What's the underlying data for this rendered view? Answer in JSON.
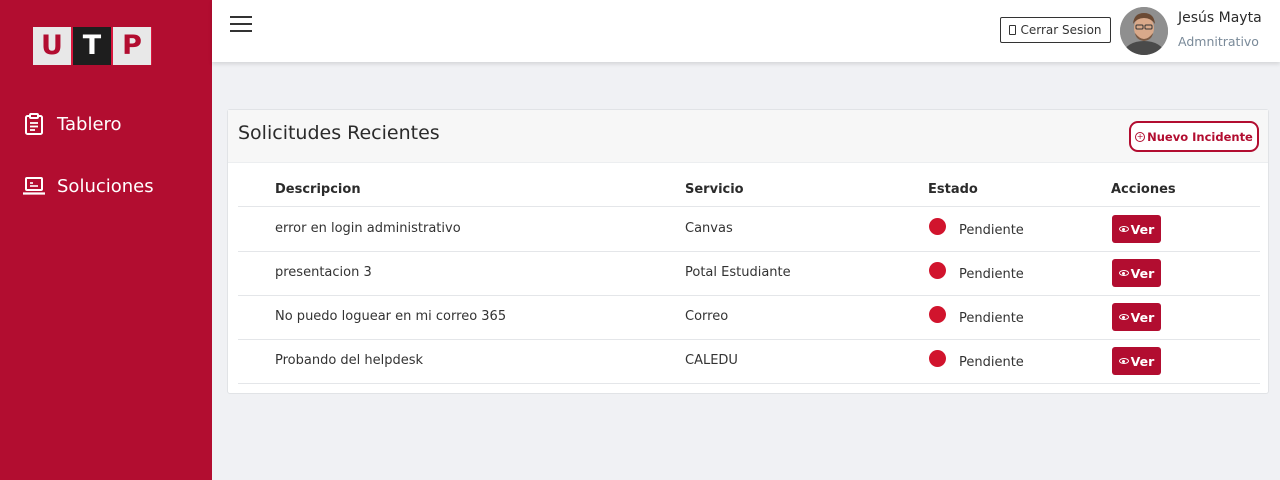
{
  "brand": {
    "letters": [
      "U",
      "T",
      "P"
    ]
  },
  "sidebar": {
    "items": [
      {
        "label": "Tablero",
        "icon": "clipboard-icon"
      },
      {
        "label": "Soluciones",
        "icon": "laptop-icon"
      }
    ]
  },
  "header": {
    "logout_label": "Cerrar Sesion",
    "user_name": "Jesús Mayta",
    "user_role": "Admnitrativo"
  },
  "card": {
    "title": "Solicitudes Recientes",
    "new_button_label": "Nuevo Incidente",
    "columns": [
      "Descripcion",
      "Servicio",
      "Estado",
      "Acciones"
    ],
    "rows": [
      {
        "descripcion": "error en login administrativo",
        "servicio": "Canvas",
        "estado": "Pendiente",
        "accion": "Ver"
      },
      {
        "descripcion": "presentacion 3",
        "servicio": "Potal Estudiante",
        "estado": "Pendiente",
        "accion": "Ver"
      },
      {
        "descripcion": "No puedo loguear en mi correo 365",
        "servicio": "Correo",
        "estado": "Pendiente",
        "accion": "Ver"
      },
      {
        "descripcion": "Probando del helpdesk",
        "servicio": "CALEDU",
        "estado": "Pendiente",
        "accion": "Ver"
      }
    ]
  },
  "colors": {
    "brand": "#b20d30",
    "status_pending": "#d1142d",
    "background": "#f0f1f4"
  }
}
